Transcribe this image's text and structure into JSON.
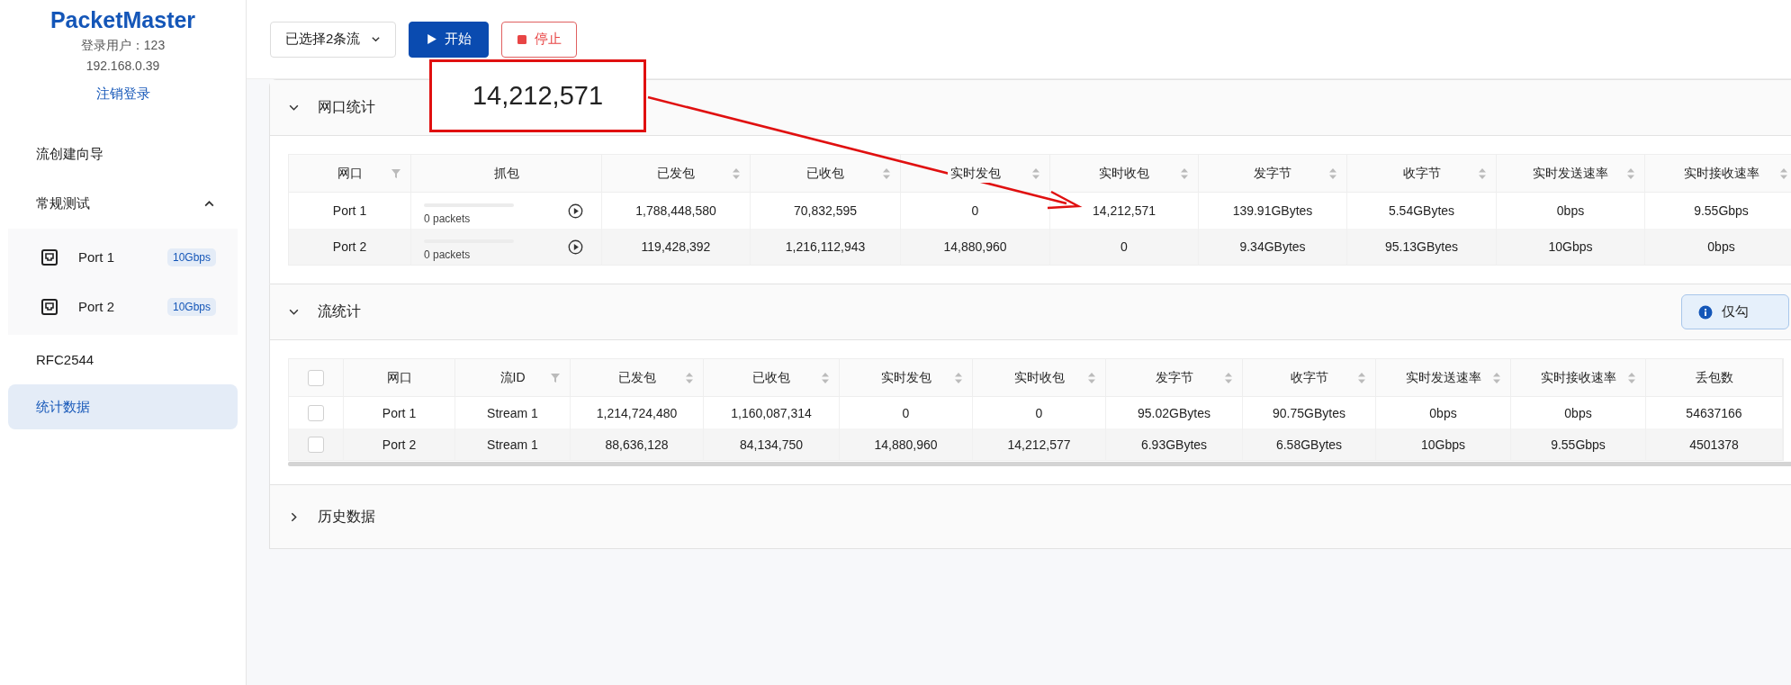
{
  "sidebar": {
    "logo": "PacketMaster",
    "user": "登录用户：123",
    "ip": "192.168.0.39",
    "logout": "注销登录",
    "nav": [
      {
        "kind": "item",
        "label": "流创建向导",
        "selected": false
      },
      {
        "kind": "group",
        "label": "常规测试",
        "selected": false,
        "expanded": true,
        "children": [
          {
            "label": "Port 1",
            "badge": "10Gbps",
            "selected": false
          },
          {
            "label": "Port 2",
            "badge": "10Gbps",
            "selected": false
          }
        ]
      },
      {
        "kind": "item",
        "label": "RFC2544",
        "selected": false
      },
      {
        "kind": "item",
        "label": "统计数据",
        "selected": true
      }
    ]
  },
  "toolbar": {
    "stream_select": "已选择2条流",
    "start": "开始",
    "stop": "停止"
  },
  "port_stats": {
    "title": "网口统计",
    "expanded": true,
    "columns": [
      {
        "label": "网口",
        "kind": "filter"
      },
      {
        "label": "抓包",
        "kind": "plain"
      },
      {
        "label": "已发包",
        "kind": "sort"
      },
      {
        "label": "已收包",
        "kind": "sort"
      },
      {
        "label": "实时发包",
        "kind": "sort"
      },
      {
        "label": "实时收包",
        "kind": "sort"
      },
      {
        "label": "发字节",
        "kind": "sort"
      },
      {
        "label": "收字节",
        "kind": "sort"
      },
      {
        "label": "实时发送速率",
        "kind": "sort"
      },
      {
        "label": "实时接收速率",
        "kind": "sort"
      }
    ],
    "rows": [
      {
        "cells": [
          "Port 1",
          {
            "level": 0,
            "text": "0 packets"
          },
          "1,788,448,580",
          "70,832,595",
          "0",
          "14,212,571",
          "139.91GBytes",
          "5.54GBytes",
          "0bps",
          "9.55Gbps"
        ]
      },
      {
        "cells": [
          "Port 2",
          {
            "level": 0,
            "text": "0 packets"
          },
          "119,428,392",
          "1,216,112,943",
          "14,880,960",
          "0",
          "9.34GBytes",
          "95.13GBytes",
          "10Gbps",
          "0bps"
        ]
      }
    ]
  },
  "stream_stats": {
    "title": "流统计",
    "expanded": true,
    "notice": "仅勾",
    "columns": [
      {
        "label": "网口",
        "kind": "plain"
      },
      {
        "label": "流ID",
        "kind": "filter"
      },
      {
        "label": "已发包",
        "kind": "sort"
      },
      {
        "label": "已收包",
        "kind": "sort"
      },
      {
        "label": "实时发包",
        "kind": "sort"
      },
      {
        "label": "实时收包",
        "kind": "sort"
      },
      {
        "label": "发字节",
        "kind": "sort"
      },
      {
        "label": "收字节",
        "kind": "sort"
      },
      {
        "label": "实时发送速率",
        "kind": "sort"
      },
      {
        "label": "实时接收速率",
        "kind": "sort"
      },
      {
        "label": "丢包数",
        "kind": "plain"
      }
    ],
    "header_checked": false,
    "rows": [
      {
        "checked": false,
        "cells": [
          "Port 1",
          "Stream 1",
          "1,214,724,480",
          "1,160,087,314",
          "0",
          "0",
          "95.02GBytes",
          "90.75GBytes",
          "0bps",
          "0bps",
          "54637166"
        ]
      },
      {
        "checked": false,
        "cells": [
          "Port 2",
          "Stream 1",
          "88,636,128",
          "84,134,750",
          "14,880,960",
          "14,212,577",
          "6.93GBytes",
          "6.58GBytes",
          "10Gbps",
          "9.55Gbps",
          "4501378"
        ]
      }
    ]
  },
  "history": {
    "title": "历史数据",
    "expanded": false
  },
  "annotation": {
    "callout": "14,212,571"
  }
}
